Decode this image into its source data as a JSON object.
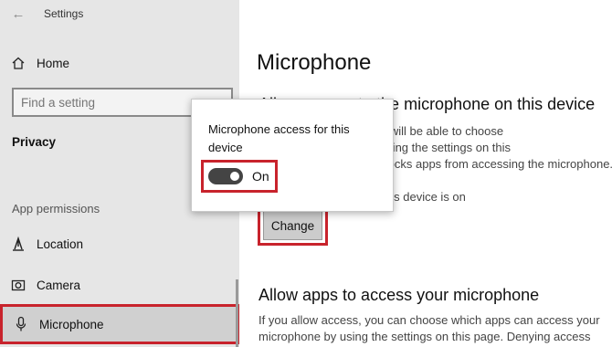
{
  "window": {
    "title": "Settings"
  },
  "sidebar": {
    "home_label": "Home",
    "search_placeholder": "Find a setting",
    "section_title": "Privacy",
    "group_title": "App permissions",
    "items": [
      {
        "label": "Location",
        "icon": "location-icon"
      },
      {
        "label": "Camera",
        "icon": "camera-icon"
      },
      {
        "label": "Microphone",
        "icon": "microphone-icon",
        "selected": true
      }
    ]
  },
  "main": {
    "page_title": "Microphone",
    "device_section": {
      "heading": "Allow access to the microphone on this device",
      "description_lines": [
        "People using this device will be able to choose",
        "microphone access by using the settings on this",
        "page. Denying access blocks apps from accessing the microphone."
      ],
      "status": "Microphone access for this device is on",
      "change_button": "Change"
    },
    "apps_section": {
      "heading": "Allow apps to access your microphone",
      "description_lines": [
        "If you allow access, you can choose which apps can access your",
        "microphone by using the settings on this page. Denying access"
      ]
    }
  },
  "popup": {
    "text": "Microphone access for this device",
    "toggle_label": "On",
    "toggle_state": "on"
  },
  "colors": {
    "highlight": "#c8232c",
    "sidebar_bg": "#e6e6e6",
    "toggle_on": "#444444"
  }
}
